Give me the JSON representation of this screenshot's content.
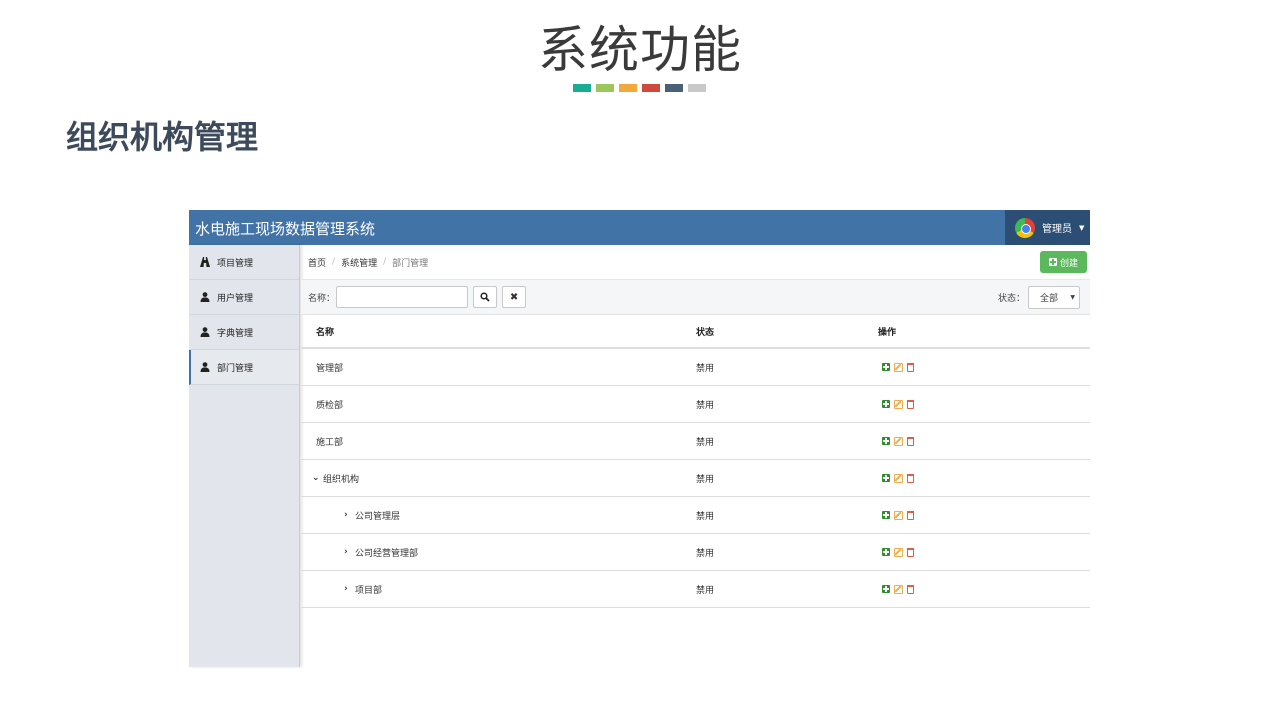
{
  "slide": {
    "title": "系统功能",
    "section_title": "组织机构管理",
    "color_swatches": [
      "#1aab95",
      "#9cc55a",
      "#f2a93b",
      "#cf4a3c",
      "#4a5f78",
      "#c8c8c8"
    ]
  },
  "app": {
    "title": "水电施工现场数据管理系统",
    "user": {
      "name": "管理员",
      "avatar_icon": "chrome-avatar-icon"
    },
    "brand_color": "#4173a6"
  },
  "sidebar": {
    "items": [
      {
        "label": "项目管理",
        "icon": "road-icon",
        "active": false
      },
      {
        "label": "用户管理",
        "icon": "user-icon",
        "active": false
      },
      {
        "label": "字典管理",
        "icon": "user-icon",
        "active": false
      },
      {
        "label": "部门管理",
        "icon": "user-icon",
        "active": true
      }
    ]
  },
  "breadcrumb": {
    "home": "首页",
    "section": "系统管理",
    "current": "部门管理"
  },
  "toolbar": {
    "create_label": "创建"
  },
  "filter": {
    "name_label": "名称：",
    "name_value": "",
    "status_label": "状态：",
    "status_value": "全部"
  },
  "table": {
    "headers": {
      "name": "名称",
      "status": "状态",
      "ops": "操作"
    },
    "rows": [
      {
        "name": "管理部",
        "status": "禁用"
      },
      {
        "name": "质检部",
        "status": "禁用"
      },
      {
        "name": "施工部",
        "status": "禁用"
      },
      {
        "name": "组织机构",
        "status": "禁用"
      },
      {
        "name": "公司管理层",
        "status": "禁用"
      },
      {
        "name": "公司经营管理部",
        "status": "禁用"
      },
      {
        "name": "项目部",
        "status": "禁用"
      }
    ]
  }
}
